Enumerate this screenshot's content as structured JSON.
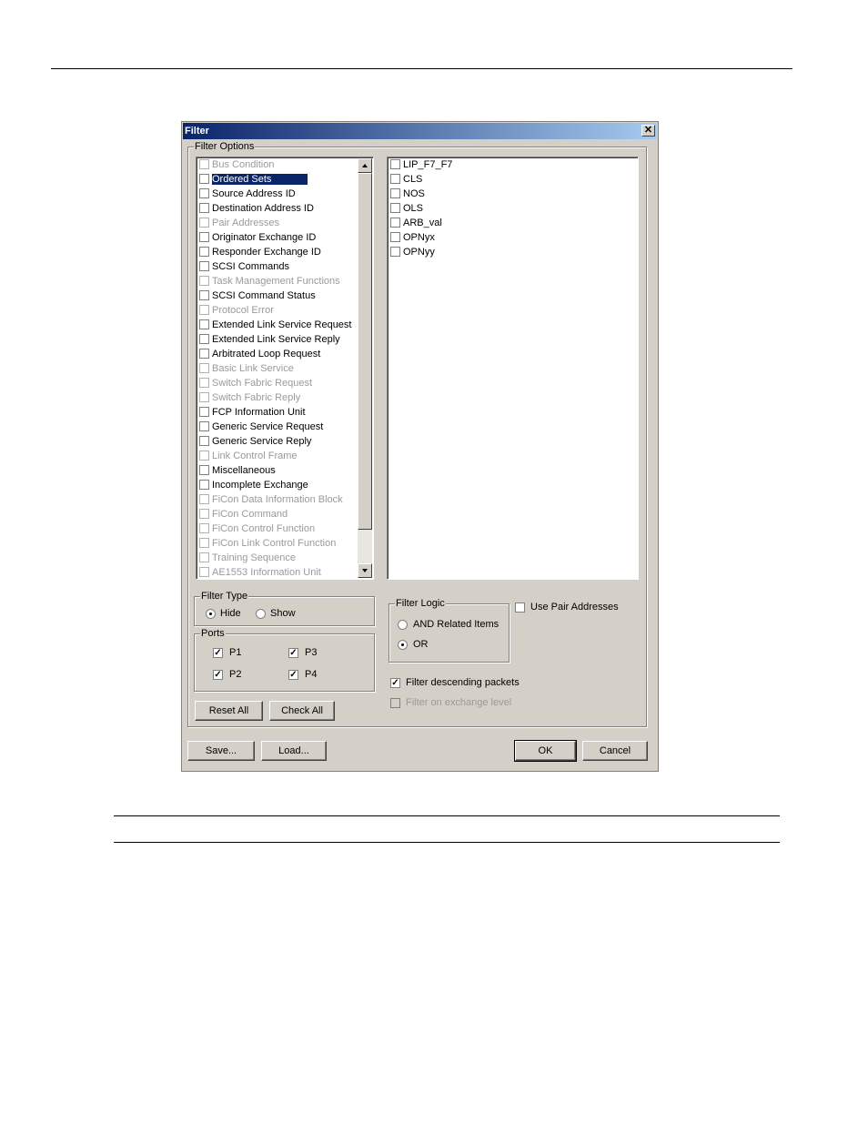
{
  "dialog": {
    "title": "Filter",
    "close_glyph": "✕"
  },
  "filter_options": {
    "label": "Filter Options",
    "items": [
      {
        "label": "Bus Condition",
        "enabled": false,
        "selected": false
      },
      {
        "label": "Ordered Sets",
        "enabled": true,
        "selected": true
      },
      {
        "label": "Source Address ID",
        "enabled": true,
        "selected": false
      },
      {
        "label": "Destination Address ID",
        "enabled": true,
        "selected": false
      },
      {
        "label": "Pair Addresses",
        "enabled": false,
        "selected": false
      },
      {
        "label": "Originator Exchange ID",
        "enabled": true,
        "selected": false
      },
      {
        "label": "Responder Exchange ID",
        "enabled": true,
        "selected": false
      },
      {
        "label": "SCSI Commands",
        "enabled": true,
        "selected": false
      },
      {
        "label": "Task Management Functions",
        "enabled": false,
        "selected": false
      },
      {
        "label": "SCSI Command Status",
        "enabled": true,
        "selected": false
      },
      {
        "label": "Protocol Error",
        "enabled": false,
        "selected": false
      },
      {
        "label": "Extended Link Service Request",
        "enabled": true,
        "selected": false
      },
      {
        "label": "Extended Link Service Reply",
        "enabled": true,
        "selected": false
      },
      {
        "label": "Arbitrated Loop Request",
        "enabled": true,
        "selected": false
      },
      {
        "label": "Basic Link Service",
        "enabled": false,
        "selected": false
      },
      {
        "label": "Switch Fabric Request",
        "enabled": false,
        "selected": false
      },
      {
        "label": "Switch Fabric Reply",
        "enabled": false,
        "selected": false
      },
      {
        "label": "FCP Information Unit",
        "enabled": true,
        "selected": false
      },
      {
        "label": "Generic Service Request",
        "enabled": true,
        "selected": false
      },
      {
        "label": "Generic Service Reply",
        "enabled": true,
        "selected": false
      },
      {
        "label": "Link Control Frame",
        "enabled": false,
        "selected": false
      },
      {
        "label": "Miscellaneous",
        "enabled": true,
        "selected": false
      },
      {
        "label": "Incomplete Exchange",
        "enabled": true,
        "selected": false
      },
      {
        "label": "FiCon Data Information Block",
        "enabled": false,
        "selected": false
      },
      {
        "label": "FiCon Command",
        "enabled": false,
        "selected": false
      },
      {
        "label": "FiCon Control Function",
        "enabled": false,
        "selected": false
      },
      {
        "label": "FiCon Link Control Function",
        "enabled": false,
        "selected": false
      },
      {
        "label": "Training Sequence",
        "enabled": false,
        "selected": false
      },
      {
        "label": "AE1553 Information Unit",
        "enabled": false,
        "selected": false
      }
    ],
    "sub_items": [
      "LIP_F7_F7",
      "CLS",
      "NOS",
      "OLS",
      "ARB_val",
      "OPNyx",
      "OPNyy"
    ]
  },
  "filter_type": {
    "label": "Filter Type",
    "options": [
      {
        "label": "Hide",
        "checked": true
      },
      {
        "label": "Show",
        "checked": false
      }
    ]
  },
  "ports": {
    "label": "Ports",
    "items": [
      {
        "label": "P1",
        "checked": true
      },
      {
        "label": "P3",
        "checked": true
      },
      {
        "label": "P2",
        "checked": true
      },
      {
        "label": "P4",
        "checked": true
      }
    ]
  },
  "filter_logic": {
    "label": "Filter Logic",
    "options": [
      {
        "label": "AND Related Items",
        "checked": false
      },
      {
        "label": "OR",
        "checked": true
      }
    ]
  },
  "use_pair_addresses": {
    "label": "Use Pair Addresses",
    "checked": false
  },
  "filter_descending": {
    "label": "Filter descending packets",
    "checked": true
  },
  "filter_exchange": {
    "label": "Filter on exchange level",
    "checked": false,
    "enabled": false
  },
  "check_glyph": "✓",
  "buttons": {
    "reset_all": "Reset All",
    "check_all": "Check All",
    "save": "Save...",
    "load": "Load...",
    "ok": "OK",
    "cancel": "Cancel"
  }
}
